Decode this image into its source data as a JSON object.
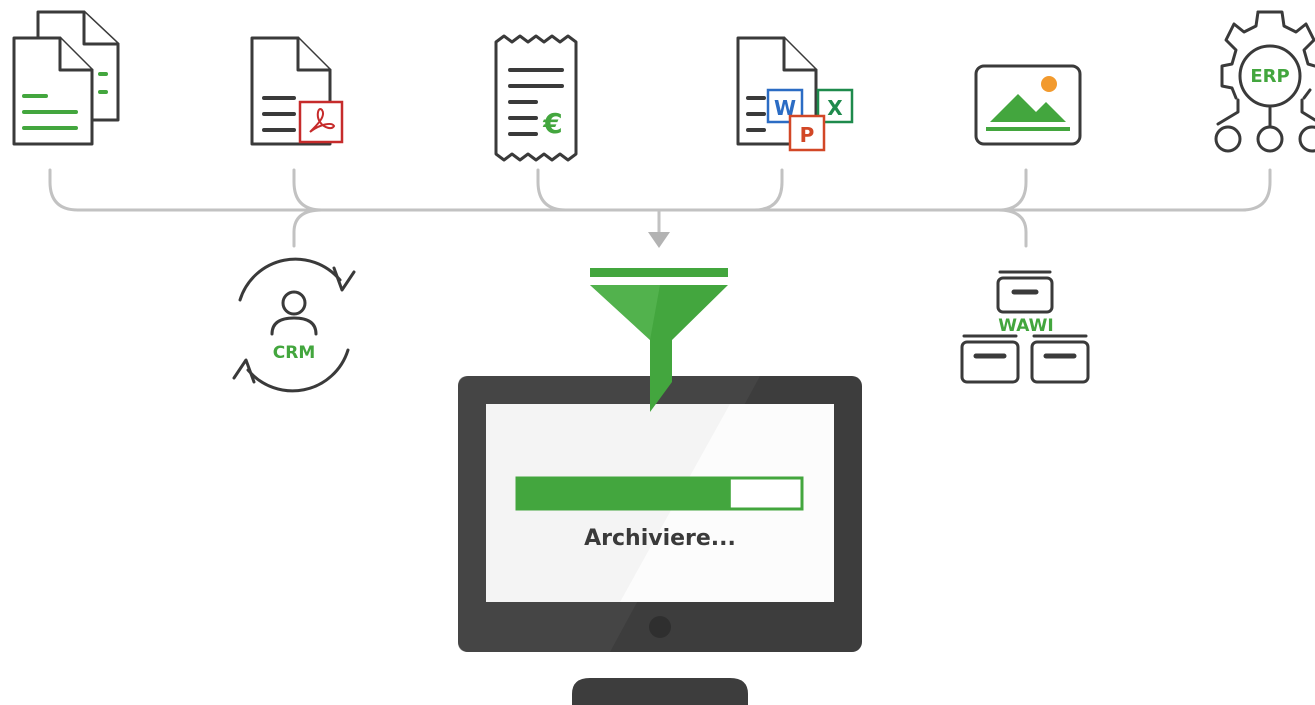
{
  "colors": {
    "green": "#43a63e",
    "dark": "#3a3a3a",
    "connector": "#bdbdbd",
    "pdf_red": "#c62b2b",
    "word_blue": "#2b6cc4",
    "excel_green": "#1e8a4c",
    "ppt_orange": "#d24726",
    "image_sun": "#f29a2e",
    "monitor_bezel": "#3d3d3d",
    "screen": "#f4f4f4"
  },
  "sources": [
    {
      "icon": "text-documents-icon"
    },
    {
      "icon": "pdf-document-icon"
    },
    {
      "icon": "euro-receipt-icon"
    },
    {
      "icon": "office-documents-icon"
    },
    {
      "icon": "image-icon"
    },
    {
      "icon": "erp-system-icon",
      "label": "ERP"
    }
  ],
  "secondary_sources": [
    {
      "icon": "crm-system-icon",
      "label": "CRM"
    },
    {
      "icon": "wawi-system-icon",
      "label": "WAWI"
    }
  ],
  "office_letters": {
    "word": "W",
    "excel": "X",
    "powerpoint": "P"
  },
  "currency_symbol": "€",
  "archive": {
    "status_text": "Archiviere...",
    "progress": 0.75
  }
}
